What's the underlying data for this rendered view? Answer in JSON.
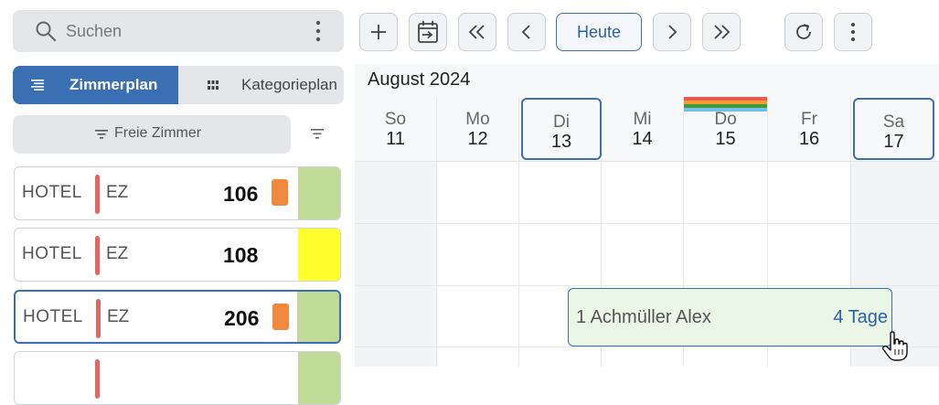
{
  "search": {
    "placeholder": "Suchen"
  },
  "views": {
    "room_plan": "Zimmerplan",
    "category_plan": "Kategorieplan"
  },
  "filter": {
    "free_rooms": "Freie Zimmer"
  },
  "rooms": [
    {
      "hotel": "HOTEL",
      "category": "EZ",
      "number": "106",
      "has_flag": true,
      "status_color": "#c0da98"
    },
    {
      "hotel": "HOTEL",
      "category": "EZ",
      "number": "108",
      "has_flag": false,
      "status_color": "#ffff2e"
    },
    {
      "hotel": "HOTEL",
      "category": "EZ",
      "number": "206",
      "has_flag": true,
      "status_color": "#c0da98"
    },
    {
      "hotel": "",
      "category": "",
      "number": "",
      "has_flag": false,
      "status_color": "#c0da98"
    }
  ],
  "toolbar": {
    "today_label": "Heute"
  },
  "calendar": {
    "month_label": "August 2024",
    "days": [
      {
        "name": "So",
        "date": "11"
      },
      {
        "name": "Mo",
        "date": "12"
      },
      {
        "name": "Di",
        "date": "13"
      },
      {
        "name": "Mi",
        "date": "14"
      },
      {
        "name": "Do",
        "date": "15"
      },
      {
        "name": "Fr",
        "date": "16"
      },
      {
        "name": "Sa",
        "date": "17"
      }
    ]
  },
  "booking": {
    "guest": "1 Achmüller Alex",
    "duration": "4 Tage"
  },
  "colors": {
    "accent": "#3a6fb4",
    "room_bar": "#e06666",
    "flag": "#f0883e",
    "booking_bg": "#eaf7e6",
    "holiday_stripes": [
      "#e85a4f",
      "#f0a030",
      "#3f9a3f",
      "#6fc3e8"
    ]
  }
}
